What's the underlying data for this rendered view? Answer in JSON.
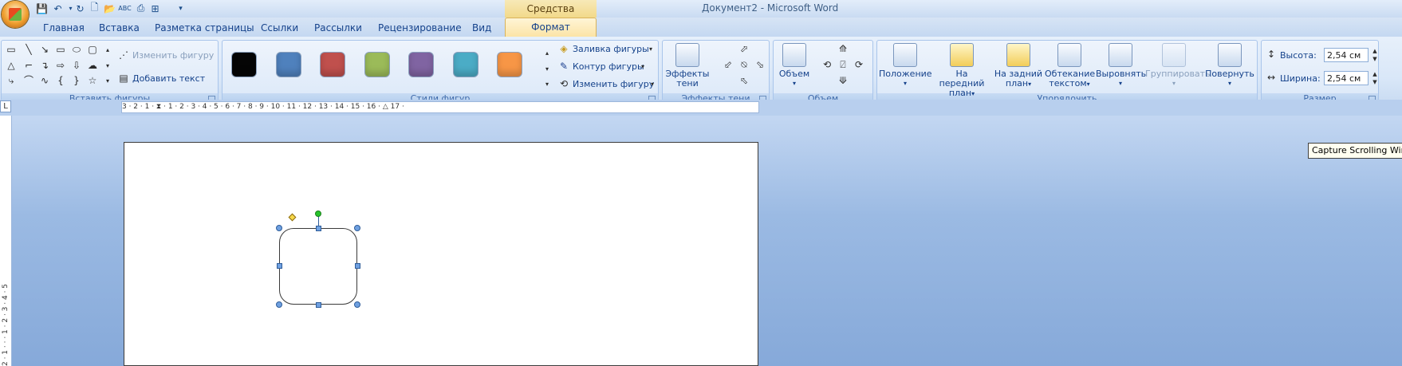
{
  "window": {
    "title": "Документ2 - Microsoft Word",
    "context_tab_group": "Средства рисования"
  },
  "tabs": [
    "Главная",
    "Вставка",
    "Разметка страницы",
    "Ссылки",
    "Рассылки",
    "Рецензирование",
    "Вид"
  ],
  "active_tab": "Формат",
  "groups": {
    "insert_shapes": {
      "label": "Вставить фигуры",
      "edit_shape": "Изменить фигуру",
      "add_text": "Добавить текст"
    },
    "shape_styles": {
      "label": "Стили фигур",
      "swatches": [
        "#050505",
        "#4f81bd",
        "#c0504d",
        "#9bbb59",
        "#8064a2",
        "#4bacc6",
        "#f79646"
      ],
      "fill": "Заливка фигуры",
      "outline": "Контур фигуры",
      "change": "Изменить фигуру"
    },
    "shadow_effects": {
      "label": "Эффекты тени",
      "button_line1": "Эффекты",
      "button_line2": "тени"
    },
    "volume": {
      "label": "Объем",
      "button": "Объем"
    },
    "arrange": {
      "label": "Упорядочить",
      "position": "Положение",
      "front_line1": "На передний",
      "front_line2": "план",
      "back_line1": "На задний",
      "back_line2": "план",
      "wrap_line1": "Обтекание",
      "wrap_line2": "текстом",
      "align": "Выровнять",
      "group": "Группировать",
      "rotate": "Повернуть"
    },
    "size": {
      "label": "Размер",
      "height_label": "Высота:",
      "height_value": "2,54 см",
      "width_label": "Ширина:",
      "width_value": "2,54 см"
    }
  },
  "ruler": {
    "numbers": "3 · 2 · 1 · ⧗ · 1 · 2 · 3 · 4 · 5 · 6 · 7 · 8 · 9 · 10 · 11 · 12 · 13 · 14 · 15 · 16 · △ 17 ·",
    "corner": "L",
    "vertical": "2 · 1 · · · 1 · 2 · 3 · 4 · 5"
  },
  "tooltip": "Capture Scrolling Windo"
}
